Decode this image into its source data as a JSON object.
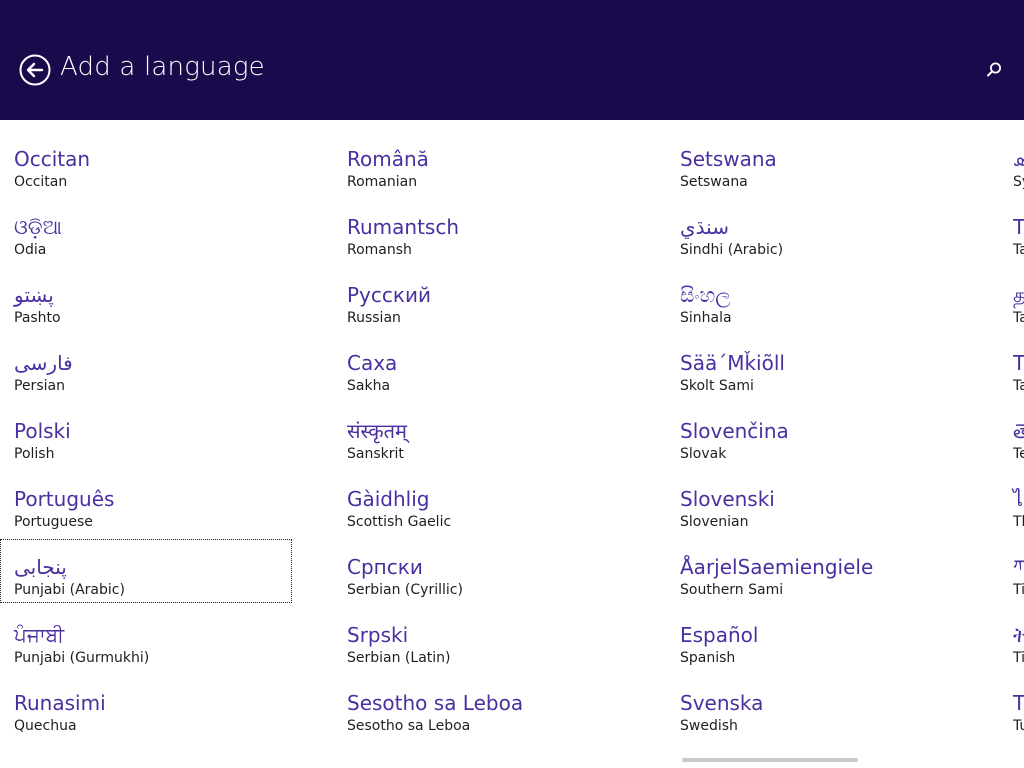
{
  "header": {
    "title": "Add a language",
    "back_icon": "back-arrow-circle-icon",
    "search_icon": "search-icon",
    "background": "#1b0a4b"
  },
  "columns": [
    [
      {
        "native": "Occitan",
        "english": "Occitan"
      },
      {
        "native": "ଓଡ଼ିଆ",
        "english": "Odia"
      },
      {
        "native": "پښتو",
        "english": "Pashto"
      },
      {
        "native": "فارسی",
        "english": "Persian"
      },
      {
        "native": "Polski",
        "english": "Polish"
      },
      {
        "native": "Português",
        "english": "Portuguese"
      },
      {
        "native": "پنجابی",
        "english": "Punjabi (Arabic)",
        "selected": true
      },
      {
        "native": "ਪੰਜਾਬੀ",
        "english": "Punjabi (Gurmukhi)"
      },
      {
        "native": "Runasimi",
        "english": "Quechua"
      }
    ],
    [
      {
        "native": "Română",
        "english": "Romanian"
      },
      {
        "native": "Rumantsch",
        "english": "Romansh"
      },
      {
        "native": "Русский",
        "english": "Russian"
      },
      {
        "native": "Саха",
        "english": "Sakha"
      },
      {
        "native": "संस्कृतम्",
        "english": "Sanskrit"
      },
      {
        "native": "Gàidhlig",
        "english": "Scottish Gaelic"
      },
      {
        "native": "Српски",
        "english": "Serbian (Cyrillic)"
      },
      {
        "native": "Srpski",
        "english": "Serbian (Latin)"
      },
      {
        "native": "Sesotho sa Leboa",
        "english": "Sesotho sa Leboa"
      }
    ],
    [
      {
        "native": "Setswana",
        "english": "Setswana"
      },
      {
        "native": "سنڌي",
        "english": "Sindhi (Arabic)"
      },
      {
        "native": "සිංහල",
        "english": "Sinhala"
      },
      {
        "native": "Sää´Mǩiõll",
        "english": "Skolt Sami"
      },
      {
        "native": "Slovenčina",
        "english": "Slovak"
      },
      {
        "native": "Slovenski",
        "english": "Slovenian"
      },
      {
        "native": "ÅarjelSaemiengiele",
        "english": "Southern Sami"
      },
      {
        "native": "Español",
        "english": "Spanish"
      },
      {
        "native": "Svenska",
        "english": "Swedish"
      }
    ],
    [
      {
        "native": "ܣ",
        "english": "Sy"
      },
      {
        "native": "Тс",
        "english": "Ta"
      },
      {
        "native": "த",
        "english": "Ta"
      },
      {
        "native": "Та",
        "english": "Ta"
      },
      {
        "native": "తె",
        "english": "Te"
      },
      {
        "native": "ไ",
        "english": "Th"
      },
      {
        "native": "ཀ",
        "english": "Ti"
      },
      {
        "native": "ት",
        "english": "Ti"
      },
      {
        "native": "Tü",
        "english": "Tu"
      }
    ]
  ],
  "accent": "#4a2fa0"
}
